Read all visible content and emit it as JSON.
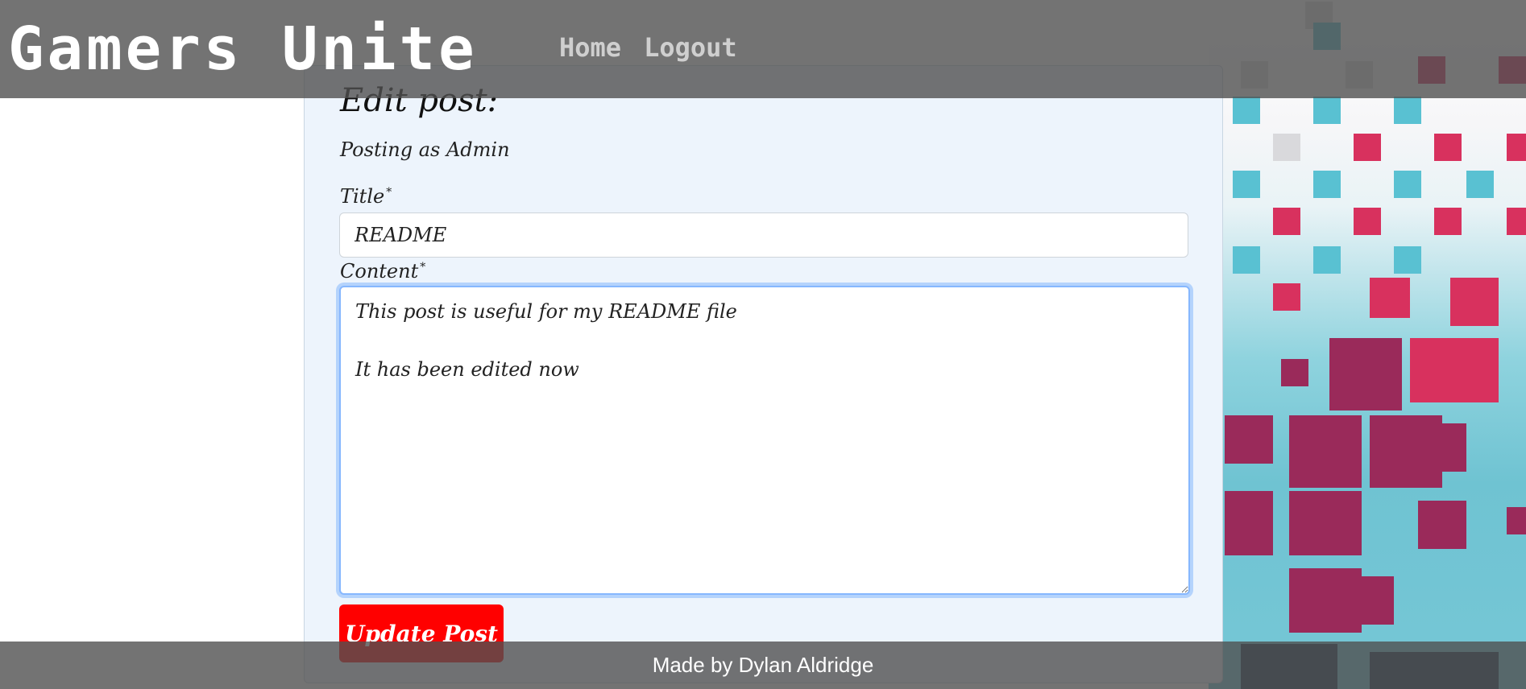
{
  "header": {
    "logo": "Gamers Unite",
    "nav": {
      "home": "Home",
      "logout": "Logout"
    }
  },
  "form": {
    "heading": "Edit post:",
    "posting_as": "Posting as Admin",
    "title_label": "Title",
    "content_label": "Content",
    "required_mark": "*",
    "title_value": "README",
    "content_value": "This post is useful for my README file\n\nIt has been edited now",
    "submit_label": "Update Post"
  },
  "footer": {
    "credit": "Made by Dylan Aldridge"
  },
  "colors": {
    "submit_button": "#ff0000",
    "card_background": "#edf4fc",
    "header_footer_overlay": "#505050"
  }
}
